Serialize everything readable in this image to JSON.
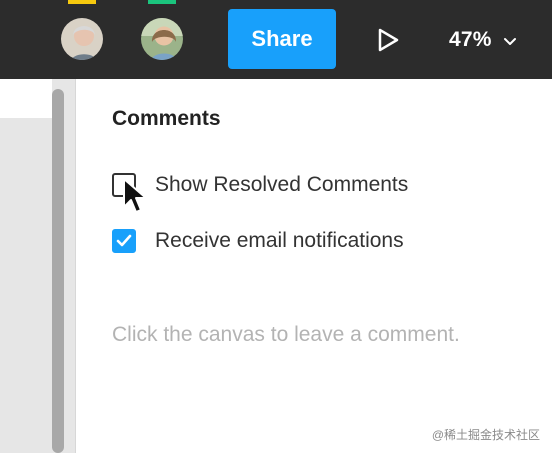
{
  "toolbar": {
    "avatars": [
      {
        "name": "collaborator-avatar-1",
        "indicator_color": "#f6c90e"
      },
      {
        "name": "collaborator-avatar-2",
        "indicator_color": "#1bc47d"
      }
    ],
    "share_label": "Share",
    "play_icon": "play-icon",
    "zoom": {
      "value": "47%",
      "chevron_icon": "chevron-down-icon"
    }
  },
  "comments_panel": {
    "title": "Comments",
    "options": [
      {
        "label": "Show Resolved Comments",
        "checked": false
      },
      {
        "label": "Receive email notifications",
        "checked": true
      }
    ],
    "hint": "Click the canvas to leave a comment."
  },
  "watermark": "@稀土掘金技术社区",
  "colors": {
    "topbar": "#2c2c2c",
    "accent": "#18a0fb",
    "hint_text": "#b3b3b3"
  }
}
